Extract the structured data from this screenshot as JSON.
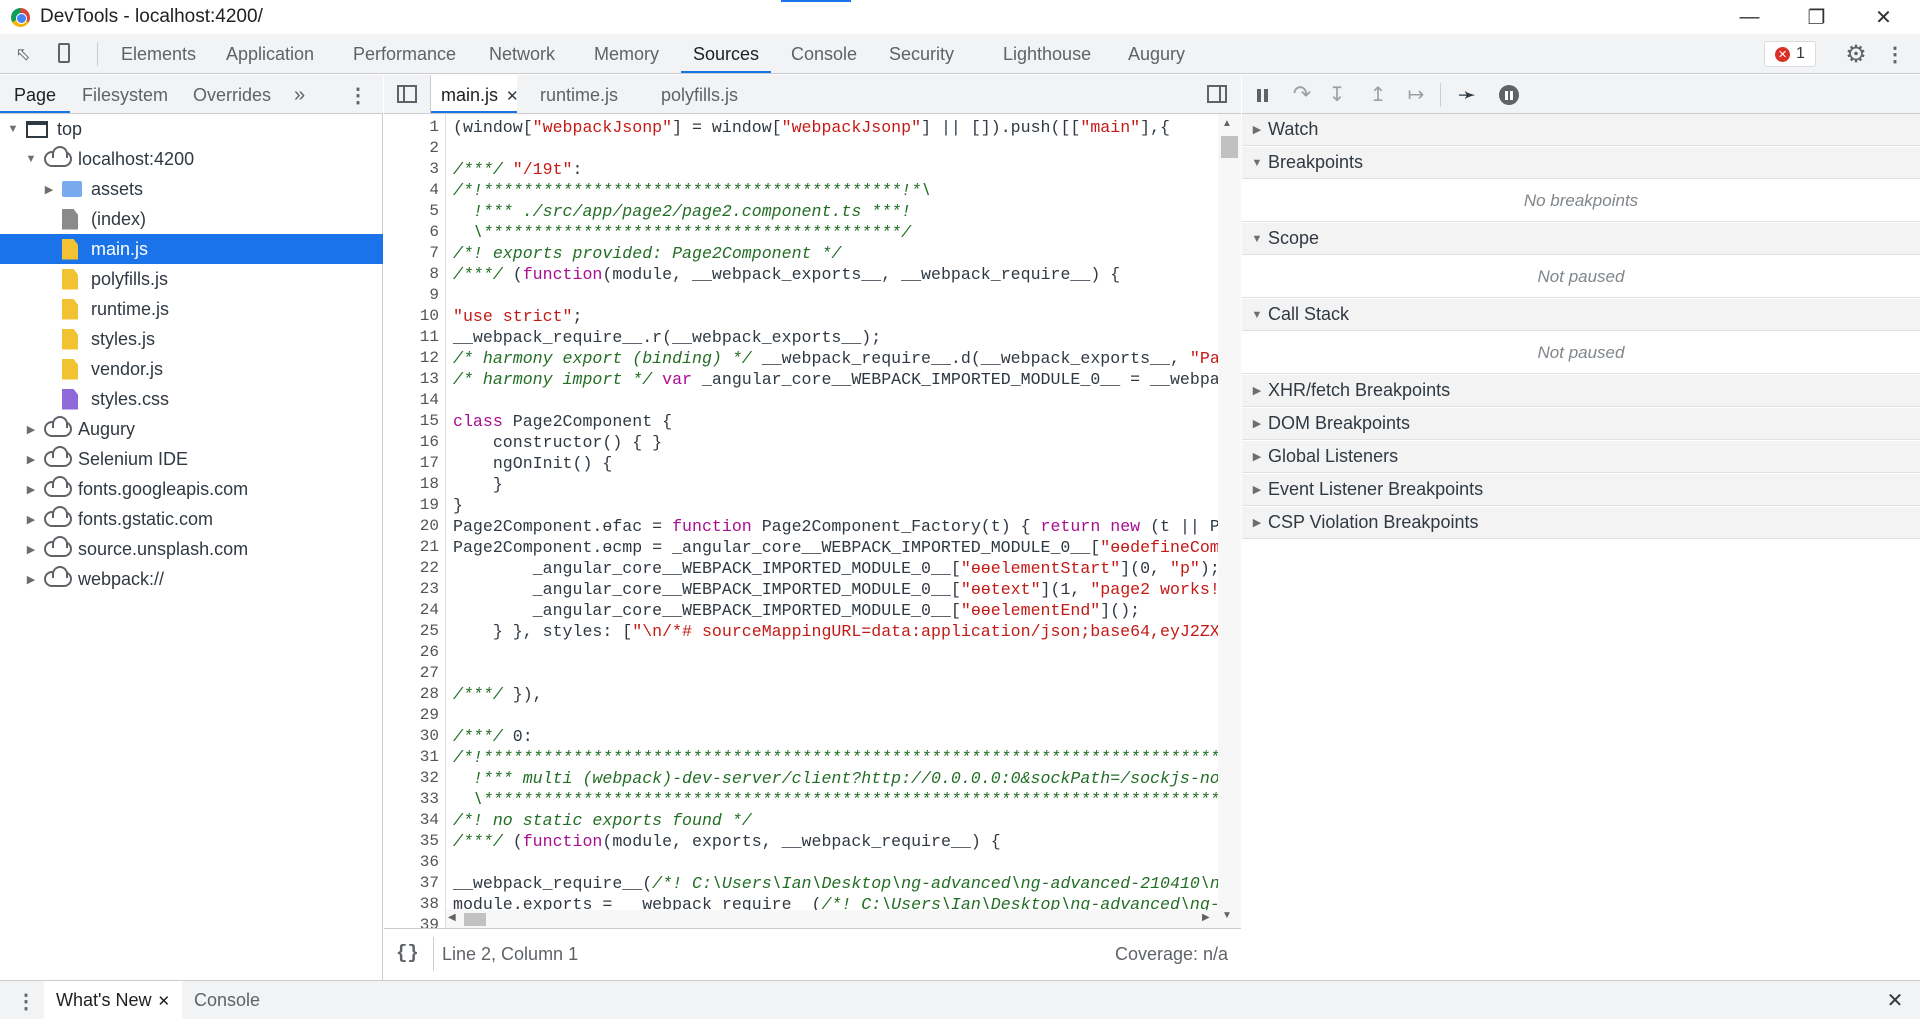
{
  "window": {
    "title": "DevTools - localhost:4200/"
  },
  "main_tabs": [
    "Elements",
    "Application",
    "Performance",
    "Network",
    "Memory",
    "Sources",
    "Console",
    "Security",
    "Lighthouse",
    "Augury"
  ],
  "active_main_tab": "Sources",
  "error_count": "1",
  "navigator": {
    "tabs": [
      "Page",
      "Filesystem",
      "Overrides"
    ],
    "more": "»",
    "tree": [
      {
        "label": "top",
        "depth": 0,
        "arrow": "▼",
        "icon": "frame"
      },
      {
        "label": "localhost:4200",
        "depth": 1,
        "arrow": "▼",
        "icon": "cloud"
      },
      {
        "label": "assets",
        "depth": 2,
        "arrow": "▶",
        "icon": "folder"
      },
      {
        "label": "(index)",
        "depth": 2,
        "arrow": "",
        "icon": "file-gray"
      },
      {
        "label": "main.js",
        "depth": 2,
        "arrow": "",
        "icon": "file-yellow",
        "selected": true
      },
      {
        "label": "polyfills.js",
        "depth": 2,
        "arrow": "",
        "icon": "file-yellow"
      },
      {
        "label": "runtime.js",
        "depth": 2,
        "arrow": "",
        "icon": "file-yellow"
      },
      {
        "label": "styles.js",
        "depth": 2,
        "arrow": "",
        "icon": "file-yellow"
      },
      {
        "label": "vendor.js",
        "depth": 2,
        "arrow": "",
        "icon": "file-yellow"
      },
      {
        "label": "styles.css",
        "depth": 2,
        "arrow": "",
        "icon": "file-purple"
      },
      {
        "label": "Augury",
        "depth": 1,
        "arrow": "▶",
        "icon": "cloud"
      },
      {
        "label": "Selenium IDE",
        "depth": 1,
        "arrow": "▶",
        "icon": "cloud"
      },
      {
        "label": "fonts.googleapis.com",
        "depth": 1,
        "arrow": "▶",
        "icon": "cloud"
      },
      {
        "label": "fonts.gstatic.com",
        "depth": 1,
        "arrow": "▶",
        "icon": "cloud"
      },
      {
        "label": "source.unsplash.com",
        "depth": 1,
        "arrow": "▶",
        "icon": "cloud"
      },
      {
        "label": "webpack://",
        "depth": 1,
        "arrow": "▶",
        "icon": "cloud"
      }
    ]
  },
  "editor": {
    "tabs": [
      {
        "label": "main.js",
        "closable": true
      },
      {
        "label": "runtime.js"
      },
      {
        "label": "polyfills.js"
      }
    ],
    "lines": [
      [
        [
          "",
          "(window["
        ],
        [
          "st",
          "\"webpackJsonp\""
        ],
        [
          "",
          "] = window["
        ],
        [
          "st",
          "\"webpackJsonp\""
        ],
        [
          "",
          "] || []).push([["
        ],
        [
          "st",
          "\"main\""
        ],
        [
          "",
          "],{"
        ]
      ],
      [],
      [
        [
          "cm",
          "/***/ "
        ],
        [
          "st",
          "\"/19t\""
        ],
        [
          "",
          ":"
        ]
      ],
      [
        [
          "cm",
          "/*!******************************************!*\\"
        ]
      ],
      [
        [
          "cm",
          "  !*** ./src/app/page2/page2.component.ts ***!"
        ]
      ],
      [
        [
          "cm",
          "  \\******************************************/"
        ]
      ],
      [
        [
          "cm",
          "/*! exports provided: Page2Component */"
        ]
      ],
      [
        [
          "cm",
          "/***/ "
        ],
        [
          "",
          "("
        ],
        [
          "kw",
          "function"
        ],
        [
          "",
          "(module, __webpack_exports__, __webpack_require__) {"
        ]
      ],
      [],
      [
        [
          "st",
          "\"use strict\""
        ],
        [
          "",
          ";"
        ]
      ],
      [
        [
          "",
          "__webpack_require__.r(__webpack_exports__);"
        ]
      ],
      [
        [
          "cm",
          "/* harmony export (binding) */ "
        ],
        [
          "",
          "__webpack_require__.d(__webpack_exports__, "
        ],
        [
          "st",
          "\"Pa"
        ]
      ],
      [
        [
          "cm",
          "/* harmony import */ "
        ],
        [
          "kw",
          "var"
        ],
        [
          "",
          " _angular_core__WEBPACK_IMPORTED_MODULE_0__ = __webpa"
        ]
      ],
      [],
      [
        [
          "kw",
          "class"
        ],
        [
          "",
          " Page2Component {"
        ]
      ],
      [
        [
          "",
          "    constructor() { }"
        ]
      ],
      [
        [
          "",
          "    ngOnInit() {"
        ]
      ],
      [
        [
          "",
          "    }"
        ]
      ],
      [
        [
          "",
          "}"
        ]
      ],
      [
        [
          "",
          "Page2Component.ɵfac = "
        ],
        [
          "kw",
          "function"
        ],
        [
          "",
          " Page2Component_Factory(t) { "
        ],
        [
          "kw",
          "return new"
        ],
        [
          "",
          " (t || P"
        ]
      ],
      [
        [
          "",
          "Page2Component.ɵcmp = _angular_core__WEBPACK_IMPORTED_MODULE_0__["
        ],
        [
          "st",
          "\"ɵɵdefineComp"
        ]
      ],
      [
        [
          "",
          "        _angular_core__WEBPACK_IMPORTED_MODULE_0__["
        ],
        [
          "st",
          "\"ɵɵelementStart\""
        ],
        [
          "",
          "](0, "
        ],
        [
          "st",
          "\"p\""
        ],
        [
          "",
          ");"
        ]
      ],
      [
        [
          "",
          "        _angular_core__WEBPACK_IMPORTED_MODULE_0__["
        ],
        [
          "st",
          "\"ɵɵtext\""
        ],
        [
          "",
          "](1, "
        ],
        [
          "st",
          "\"page2 works!"
        ]
      ],
      [
        [
          "",
          "        _angular_core__WEBPACK_IMPORTED_MODULE_0__["
        ],
        [
          "st",
          "\"ɵɵelementEnd\""
        ],
        [
          "",
          "]();"
        ]
      ],
      [
        [
          "",
          "    } }, styles: ["
        ],
        [
          "st",
          "\"\\n/*# sourceMappingURL=data:application/json;base64,eyJ2ZX"
        ]
      ],
      [],
      [],
      [
        [
          "cm",
          "/***/ "
        ],
        [
          "",
          "}),"
        ]
      ],
      [],
      [
        [
          "cm",
          "/***/ "
        ],
        [
          "",
          "0:"
        ]
      ],
      [
        [
          "cm",
          "/*!**************************************************************************"
        ]
      ],
      [
        [
          "cm",
          "  !*** multi (webpack)-dev-server/client?http://0.0.0.0:0&sockPath=/sockjs-no"
        ]
      ],
      [
        [
          "cm",
          "  \\**************************************************************************"
        ]
      ],
      [
        [
          "cm",
          "/*! no static exports found */"
        ]
      ],
      [
        [
          "cm",
          "/***/ "
        ],
        [
          "",
          "("
        ],
        [
          "kw",
          "function"
        ],
        [
          "",
          "(module, exports, __webpack_require__) {"
        ]
      ],
      [],
      [
        [
          "",
          "__webpack_require__("
        ],
        [
          "cm",
          "/*! C:\\Users\\Ian\\Desktop\\ng-advanced\\ng-advanced-210410\\n"
        ]
      ],
      [
        [
          "",
          "module.exports = __webpack_require__("
        ],
        [
          "cm",
          "/*! C:\\Users\\Ian\\Desktop\\ng-advanced\\ng-a"
        ]
      ],
      []
    ],
    "status": {
      "format": "{}",
      "position": "Line 2, Column 1",
      "coverage": "Coverage: n/a"
    }
  },
  "debugger": {
    "panes": [
      {
        "label": "Watch",
        "expanded": false
      },
      {
        "label": "Breakpoints",
        "expanded": true,
        "body": "No breakpoints"
      },
      {
        "label": "Scope",
        "expanded": true,
        "body": "Not paused"
      },
      {
        "label": "Call Stack",
        "expanded": true,
        "body": "Not paused"
      },
      {
        "label": "XHR/fetch Breakpoints",
        "expanded": false
      },
      {
        "label": "DOM Breakpoints",
        "expanded": false
      },
      {
        "label": "Global Listeners",
        "expanded": false
      },
      {
        "label": "Event Listener Breakpoints",
        "expanded": false
      },
      {
        "label": "CSP Violation Breakpoints",
        "expanded": false
      }
    ]
  },
  "drawer": {
    "tabs": [
      "What's New",
      "Console"
    ]
  }
}
